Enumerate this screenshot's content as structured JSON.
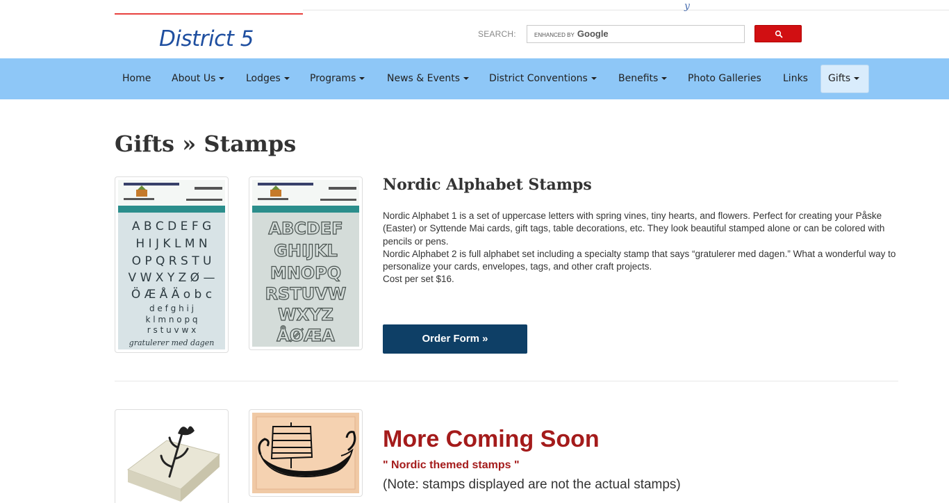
{
  "header": {
    "site_name": "District 5",
    "search_label": "SEARCH:",
    "search_watermark_prefix": "ENHANCED BY",
    "search_watermark_brand": "Google",
    "search_value": ""
  },
  "nav": {
    "items": [
      {
        "label": "Home",
        "dropdown": false
      },
      {
        "label": "About Us",
        "dropdown": true
      },
      {
        "label": "Lodges",
        "dropdown": true
      },
      {
        "label": "Programs",
        "dropdown": true
      },
      {
        "label": "News & Events",
        "dropdown": true
      },
      {
        "label": "District Conventions",
        "dropdown": true
      },
      {
        "label": "Benefits",
        "dropdown": true
      },
      {
        "label": "Photo Galleries",
        "dropdown": false
      },
      {
        "label": "Links",
        "dropdown": false
      },
      {
        "label": "Gifts",
        "dropdown": true,
        "active": true
      }
    ]
  },
  "page": {
    "title": "Gifts » Stamps"
  },
  "product": {
    "title": "Nordic Alphabet Stamps",
    "desc_lines": [
      "Nordic Alphabet 1 is a set of uppercase letters with spring vines, tiny hearts, and flowers. Perfect for creating your Påske (Easter) or Syttende Mai cards, gift tags, table decorations, etc. They look beautiful stamped alone or can be colored with pencils or pens.",
      "Nordic Alphabet 2 is full alphabet set including a specialty stamp that says “gratulerer med dagen.” What a wonderful way to personalize your cards, envelopes, tags, and other craft projects.",
      "Cost per set $16."
    ],
    "order_button": "Order Form »",
    "image1_letters": [
      "A B C D E F G",
      "H I J K L M N",
      "O P Q R S T U",
      "V W X Y Z Ø",
      "Ö Æ Å Ä"
    ],
    "image2_letters": [
      "A B C D E F",
      "G H I J K L",
      "M N O P Q",
      "R S T U V W",
      "X Y Z",
      "Å Ø Æ A"
    ],
    "image1_caption": "gratulerer med dagen",
    "image_header_left": "Sons of Norway District 5",
    "image_header_right_1": "Nordic Alphabet 2",
    "image_header_right_2": "Nordic Alphabet 1"
  },
  "coming": {
    "title": "More Coming Soon",
    "subtitle": "\" Nordic themed stamps \"",
    "note": "(Note: stamps displayed are not the actual stamps)"
  }
}
